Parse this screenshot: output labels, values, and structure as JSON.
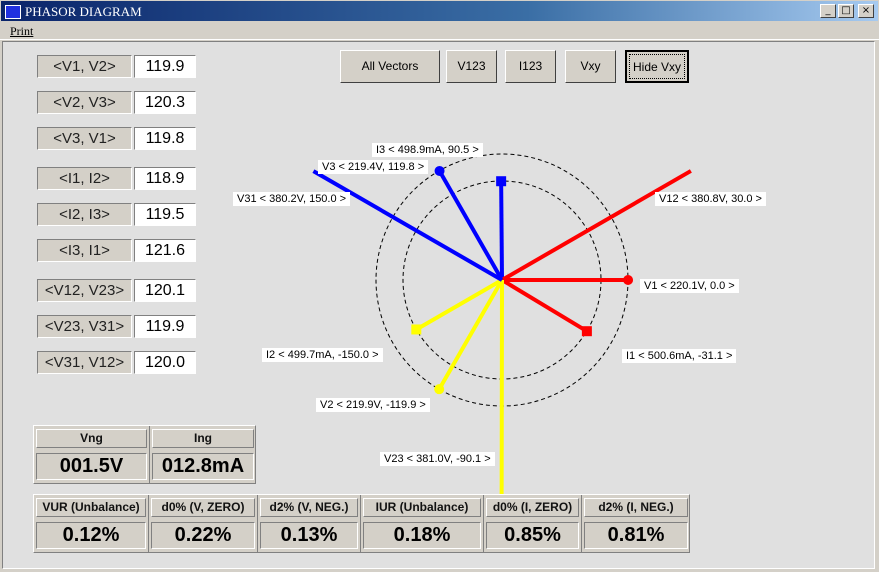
{
  "window": {
    "title": "PHASOR DIAGRAM",
    "minimize": "_",
    "maximize": "□",
    "close": "×"
  },
  "menu": {
    "print": "Print"
  },
  "angles": [
    {
      "label": "<V1, V2>",
      "value": "119.9"
    },
    {
      "label": "<V2, V3>",
      "value": "120.3"
    },
    {
      "label": "<V3, V1>",
      "value": "119.8"
    },
    {
      "label": "<I1, I2>",
      "value": "118.9"
    },
    {
      "label": "<I2, I3>",
      "value": "119.5"
    },
    {
      "label": "<I3, I1>",
      "value": "121.6"
    },
    {
      "label": "<V12, V23>",
      "value": "120.1"
    },
    {
      "label": "<V23, V31>",
      "value": "119.9"
    },
    {
      "label": "<V31, V12>",
      "value": "120.0"
    }
  ],
  "buttons": {
    "all": "All Vectors",
    "v123": "V123",
    "i123": "I123",
    "vxy": "Vxy",
    "hide": "Hide Vxy"
  },
  "phasors": [
    {
      "name": "V1",
      "label": "V1 < 220.1V, 0.0 >",
      "mag": 220.1,
      "angle": 0.0,
      "kind": "V",
      "color": "#ff0000"
    },
    {
      "name": "V2",
      "label": "V2 < 219.9V, -119.9 >",
      "mag": 219.9,
      "angle": -119.9,
      "kind": "V",
      "color": "#ffff00"
    },
    {
      "name": "V3",
      "label": "V3 < 219.4V, 119.8 >",
      "mag": 219.4,
      "angle": 119.8,
      "kind": "V",
      "color": "#0000ff"
    },
    {
      "name": "I1",
      "label": "I1 < 500.6mA, -31.1 >",
      "mag": 500.6,
      "angle": -31.1,
      "kind": "I",
      "color": "#ff0000"
    },
    {
      "name": "I2",
      "label": "I2 < 499.7mA, -150.0 >",
      "mag": 499.7,
      "angle": -150.0,
      "kind": "I",
      "color": "#ffff00"
    },
    {
      "name": "I3",
      "label": "I3 < 498.9mA, 90.5 >",
      "mag": 498.9,
      "angle": 90.5,
      "kind": "I",
      "color": "#0000ff"
    },
    {
      "name": "V12",
      "label": "V12 < 380.8V, 30.0 >",
      "mag": 380.8,
      "angle": 30.0,
      "kind": "L",
      "color": "#ff0000"
    },
    {
      "name": "V23",
      "label": "V23 < 381.0V, -90.1 >",
      "mag": 381.0,
      "angle": -90.1,
      "kind": "L",
      "color": "#ffff00"
    },
    {
      "name": "V31",
      "label": "V31 < 380.2V, 150.0 >",
      "mag": 380.2,
      "angle": 150.0,
      "kind": "L",
      "color": "#0000ff"
    }
  ],
  "neutral": {
    "vng_label": "Vng",
    "vng": "001.5V",
    "ing_label": "Ing",
    "ing": "012.8mA"
  },
  "unbalance": [
    {
      "label": "VUR (Unbalance)",
      "value": "0.12%"
    },
    {
      "label": "d0% (V, ZERO)",
      "value": "0.22%"
    },
    {
      "label": "d2% (V, NEG.)",
      "value": "0.13%"
    },
    {
      "label": "IUR (Unbalance)",
      "value": "0.18%"
    },
    {
      "label": "d0% (I, ZERO)",
      "value": "0.85%"
    },
    {
      "label": "d2% (I, NEG.)",
      "value": "0.81%"
    }
  ]
}
